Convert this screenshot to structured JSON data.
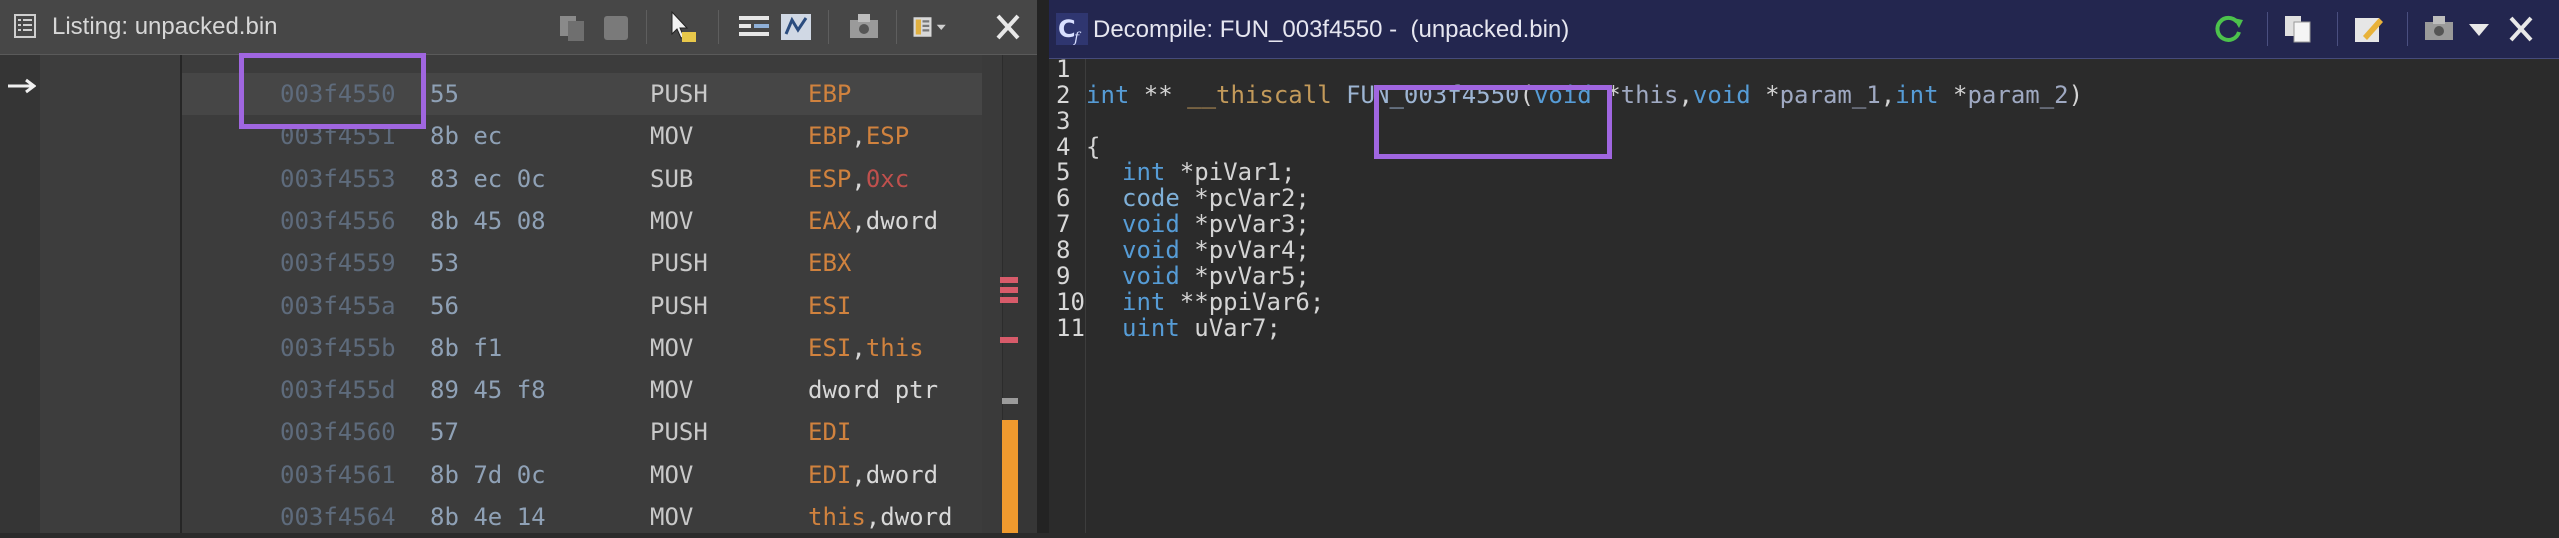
{
  "listing": {
    "title": "Listing:  unpacked.bin",
    "rows": [
      {
        "addr": "003f4550",
        "bytes": "55",
        "mnem": "PUSH",
        "op": [
          {
            "t": "EBP",
            "c": "reg"
          }
        ]
      },
      {
        "addr": "003f4551",
        "bytes": "8b ec",
        "mnem": "MOV",
        "op": [
          {
            "t": "EBP",
            "c": "reg"
          },
          {
            "t": ",",
            "c": "plain"
          },
          {
            "t": "ESP",
            "c": "reg"
          }
        ]
      },
      {
        "addr": "003f4553",
        "bytes": "83 ec 0c",
        "mnem": "SUB",
        "op": [
          {
            "t": "ESP",
            "c": "reg"
          },
          {
            "t": ",",
            "c": "plain"
          },
          {
            "t": "0xc",
            "c": "num"
          }
        ]
      },
      {
        "addr": "003f4556",
        "bytes": "8b 45 08",
        "mnem": "MOV",
        "op": [
          {
            "t": "EAX",
            "c": "reg"
          },
          {
            "t": ",dword",
            "c": "plain"
          }
        ]
      },
      {
        "addr": "003f4559",
        "bytes": "53",
        "mnem": "PUSH",
        "op": [
          {
            "t": "EBX",
            "c": "reg"
          }
        ]
      },
      {
        "addr": "003f455a",
        "bytes": "56",
        "mnem": "PUSH",
        "op": [
          {
            "t": "ESI",
            "c": "reg"
          }
        ]
      },
      {
        "addr": "003f455b",
        "bytes": "8b f1",
        "mnem": "MOV",
        "op": [
          {
            "t": "ESI",
            "c": "reg"
          },
          {
            "t": ",",
            "c": "plain"
          },
          {
            "t": "this",
            "c": "reg"
          }
        ]
      },
      {
        "addr": "003f455d",
        "bytes": "89 45 f8",
        "mnem": "MOV",
        "op": [
          {
            "t": "dword ptr",
            "c": "plain"
          }
        ]
      },
      {
        "addr": "003f4560",
        "bytes": "57",
        "mnem": "PUSH",
        "op": [
          {
            "t": "EDI",
            "c": "reg"
          }
        ]
      },
      {
        "addr": "003f4561",
        "bytes": "8b 7d 0c",
        "mnem": "MOV",
        "op": [
          {
            "t": "EDI",
            "c": "reg"
          },
          {
            "t": ",dword",
            "c": "plain"
          }
        ]
      },
      {
        "addr": "003f4564",
        "bytes": "8b 4e 14",
        "mnem": "MOV",
        "op": [
          {
            "t": "this",
            "c": "reg"
          },
          {
            "t": ",dword",
            "c": "plain"
          }
        ]
      }
    ]
  },
  "decompile": {
    "title": "Decompile: FUN_003f4550 -  (unpacked.bin)",
    "lines": [
      {
        "n": "1",
        "parts": []
      },
      {
        "n": "2",
        "parts": [
          {
            "t": "int",
            "c": "kw"
          },
          {
            "t": " ** ",
            "c": "tx"
          },
          {
            "t": "__thiscall",
            "c": "cc"
          },
          {
            "t": " ",
            "c": "tx"
          },
          {
            "t": "FUN_003f4550",
            "c": "fn"
          },
          {
            "t": "(",
            "c": "tx"
          },
          {
            "t": "void",
            "c": "kw"
          },
          {
            "t": " *",
            "c": "tx"
          },
          {
            "t": "this",
            "c": "pm"
          },
          {
            "t": ",",
            "c": "tx"
          },
          {
            "t": "void",
            "c": "kw"
          },
          {
            "t": " *",
            "c": "tx"
          },
          {
            "t": "param_1",
            "c": "pm"
          },
          {
            "t": ",",
            "c": "tx"
          },
          {
            "t": "int",
            "c": "kw"
          },
          {
            "t": " *",
            "c": "tx"
          },
          {
            "t": "param_2",
            "c": "pm"
          },
          {
            "t": ")",
            "c": "tx"
          }
        ]
      },
      {
        "n": "3",
        "parts": []
      },
      {
        "n": "4",
        "parts": [
          {
            "t": "{",
            "c": "tx"
          }
        ]
      },
      {
        "n": "5",
        "indent": true,
        "parts": [
          {
            "t": "int",
            "c": "kw"
          },
          {
            "t": " *piVar1;",
            "c": "tx"
          }
        ]
      },
      {
        "n": "6",
        "indent": true,
        "parts": [
          {
            "t": "code",
            "c": "ty"
          },
          {
            "t": " *pcVar2;",
            "c": "tx"
          }
        ]
      },
      {
        "n": "7",
        "indent": true,
        "parts": [
          {
            "t": "void",
            "c": "kw"
          },
          {
            "t": " *pvVar3;",
            "c": "tx"
          }
        ]
      },
      {
        "n": "8",
        "indent": true,
        "parts": [
          {
            "t": "void",
            "c": "kw"
          },
          {
            "t": " *pvVar4;",
            "c": "tx"
          }
        ]
      },
      {
        "n": "9",
        "indent": true,
        "parts": [
          {
            "t": "void",
            "c": "kw"
          },
          {
            "t": " *pvVar5;",
            "c": "tx"
          }
        ]
      },
      {
        "n": "10",
        "indent": true,
        "parts": [
          {
            "t": "int",
            "c": "kw"
          },
          {
            "t": " **ppiVar6;",
            "c": "tx"
          }
        ]
      },
      {
        "n": "11",
        "indent": true,
        "parts": [
          {
            "t": "uint",
            "c": "kw"
          },
          {
            "t": " uVar7;",
            "c": "tx"
          }
        ]
      }
    ]
  },
  "icons": {
    "listing_toolbar": [
      "copy-icon",
      "paste-icon",
      "cursor-select-icon",
      "listing-format-icon",
      "diff-icon",
      "snapshot-icon",
      "layout-menu-icon",
      "close-icon"
    ],
    "decompile_toolbar": [
      "refresh-icon",
      "copy-icon",
      "edit-icon",
      "snapshot-icon",
      "menu-icon",
      "close-icon"
    ]
  },
  "colors": {
    "highlight_box": "#a066e0",
    "decompile_title_bg": "#23264f",
    "register": "#d0823e",
    "keyword": "#569cd6"
  }
}
